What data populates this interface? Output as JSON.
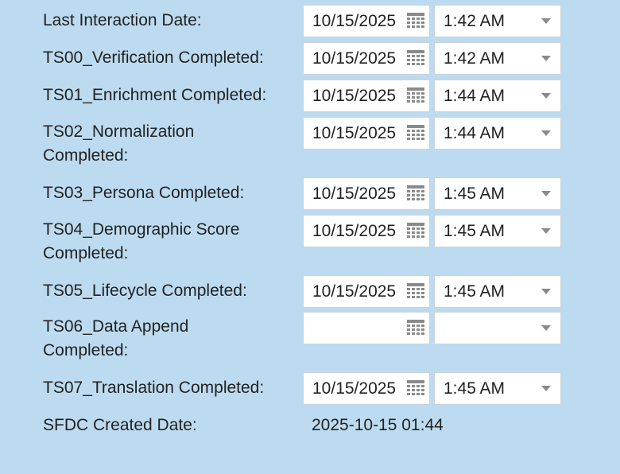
{
  "rows": [
    {
      "label": "Last Interaction Date:",
      "date": "10/15/2025",
      "time": "1:42 AM"
    },
    {
      "label": "TS00_Verification Completed:",
      "date": "10/15/2025",
      "time": "1:42 AM"
    },
    {
      "label": "TS01_Enrichment Completed:",
      "date": "10/15/2025",
      "time": "1:44 AM"
    },
    {
      "label": "TS02_Normalization Completed:",
      "date": "10/15/2025",
      "time": "1:44 AM"
    },
    {
      "label": "TS03_Persona Completed:",
      "date": "10/15/2025",
      "time": "1:45 AM"
    },
    {
      "label": "TS04_Demographic Score Completed:",
      "date": "10/15/2025",
      "time": "1:45 AM"
    },
    {
      "label": "TS05_Lifecycle Completed:",
      "date": "10/15/2025",
      "time": "1:45 AM"
    },
    {
      "label": "TS06_Data Append Completed:",
      "date": "",
      "time": ""
    },
    {
      "label": "TS07_Translation Completed:",
      "date": "10/15/2025",
      "time": "1:45 AM"
    }
  ],
  "sfdc": {
    "label": "SFDC Created Date:",
    "value": "2025-10-15 01:44"
  },
  "icons": {
    "date_picker": "calendar-icon",
    "time_dropdown": "chevron-down-icon"
  },
  "colors": {
    "background": "#bddbf0",
    "field_background": "#ffffff",
    "text": "#222222",
    "icon": "#8a8a8a"
  }
}
